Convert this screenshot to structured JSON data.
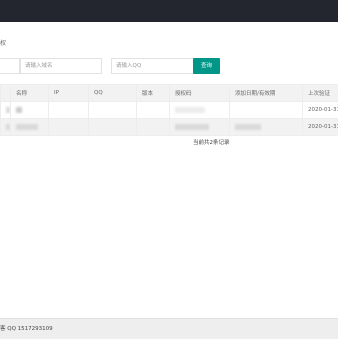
{
  "header": {
    "bg_color": "#23262e"
  },
  "panel": {
    "title_fragment": "权"
  },
  "search": {
    "domain_placeholder": "请输入域名",
    "qq_placeholder": "请输入QQ",
    "query_label": "查询",
    "accent_color": "#009688"
  },
  "table": {
    "columns": [
      "名称",
      "IP",
      "QQ",
      "版本",
      "授权码",
      "添加日期/有效期",
      "上次验证"
    ],
    "rows": [
      {
        "last_verify": "2020-01-31"
      },
      {
        "last_verify": "2020-01-31"
      }
    ]
  },
  "summary": "当前共2条记录",
  "footer": {
    "text": "客 QQ 1517293109"
  }
}
